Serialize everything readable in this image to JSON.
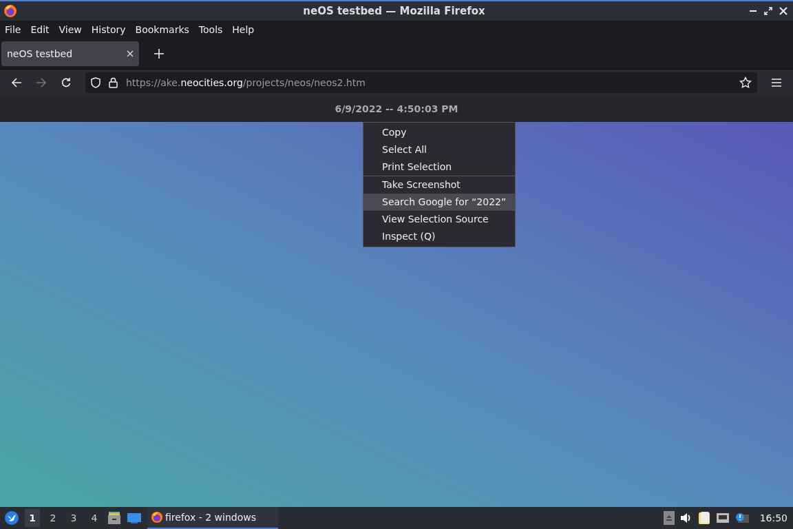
{
  "window": {
    "title": "neOS testbed — Mozilla Firefox"
  },
  "menu_bar": [
    {
      "label": "File"
    },
    {
      "label": "Edit"
    },
    {
      "label": "View"
    },
    {
      "label": "History"
    },
    {
      "label": "Bookmarks"
    },
    {
      "label": "Tools"
    },
    {
      "label": "Help"
    }
  ],
  "tabs": [
    {
      "label": "neOS testbed",
      "selected": true
    }
  ],
  "address_bar": {
    "url_prefix": "https://ake.",
    "url_domain": "neocities.org",
    "url_path": "/projects/neos/neos2.htm"
  },
  "page": {
    "header": "6/9/2022 -- 4:50:03 PM"
  },
  "context_menu": {
    "groups": [
      [
        {
          "label": "Copy",
          "selected": false
        },
        {
          "label": "Select All",
          "selected": false
        },
        {
          "label": "Print Selection",
          "selected": false
        }
      ],
      [
        {
          "label": "Take Screenshot",
          "selected": false
        },
        {
          "label": "Search Google for “2022”",
          "selected": true
        },
        {
          "label": "View Selection Source",
          "selected": false
        },
        {
          "label": "Inspect (Q)",
          "selected": false
        }
      ]
    ]
  },
  "taskbar": {
    "workspaces": [
      {
        "label": "1",
        "selected": true
      },
      {
        "label": "2",
        "selected": false
      },
      {
        "label": "3",
        "selected": false
      },
      {
        "label": "4",
        "selected": false
      }
    ],
    "task": {
      "label": "firefox - 2 windows",
      "selected": true
    },
    "clock": "16:50"
  }
}
